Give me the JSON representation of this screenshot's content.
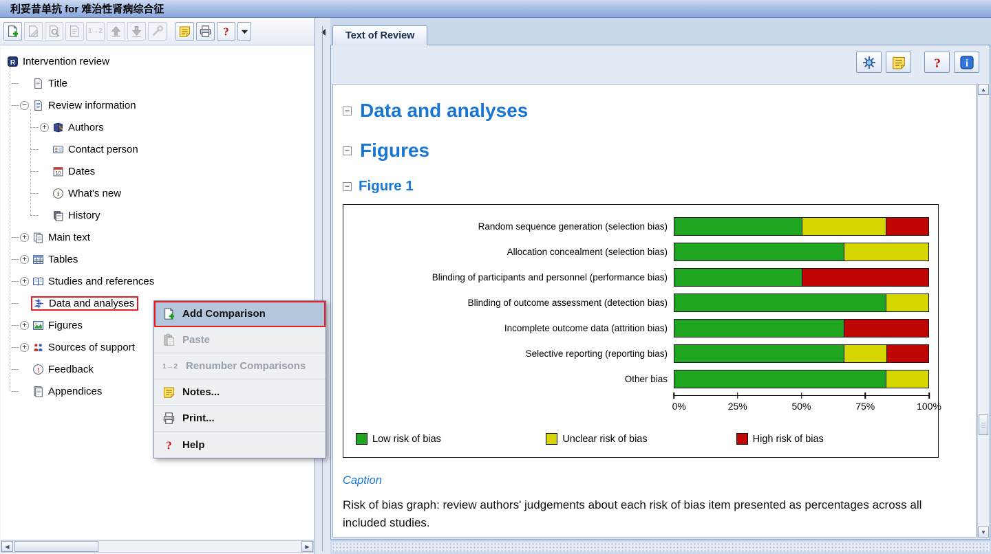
{
  "window": {
    "title": "利妥昔单抗 for 难治性肾病综合征"
  },
  "glyphs": {
    "collapse": "−",
    "expanded": "−",
    "collapsed": "+",
    "up": "▲",
    "down": "▼",
    "left": "◀",
    "right": "▶"
  },
  "colors": {
    "heading_blue": "#1976d2",
    "low_risk_green": "#1fa51f",
    "unclear_yellow": "#d5d500",
    "high_risk_red": "#c00505",
    "annotation_red": "#ec1c24"
  },
  "left_toolbar": {
    "buttons": [
      {
        "name": "new-button",
        "icon": "new-icon",
        "enabled": true
      },
      {
        "name": "edit-button",
        "icon": "edit-icon",
        "enabled": false
      },
      {
        "name": "preview-button",
        "icon": "preview-icon",
        "enabled": false
      },
      {
        "name": "properties-button",
        "icon": "properties-icon",
        "enabled": false
      },
      {
        "name": "renumber-button",
        "icon_text": "1→2",
        "enabled": false
      },
      {
        "name": "move-up-button",
        "icon": "move-up-icon",
        "enabled": false
      },
      {
        "name": "move-down-button",
        "icon": "move-down-icon",
        "enabled": false
      },
      {
        "name": "link-button",
        "icon": "wrench-icon",
        "enabled": false
      },
      {
        "name": "notes-button",
        "icon": "notes-icon",
        "enabled": true
      },
      {
        "name": "print-button",
        "icon": "print-icon",
        "enabled": true
      },
      {
        "name": "help-button",
        "icon": "help-icon",
        "enabled": true
      },
      {
        "name": "toolbar-more-button",
        "icon": "dropdown-icon",
        "enabled": true
      }
    ]
  },
  "tree": {
    "items": [
      {
        "label": "Intervention review",
        "level": 0,
        "icon": "review-icon",
        "handle": null,
        "selected": false
      },
      {
        "label": "Title",
        "level": 1,
        "icon": "title-icon",
        "handle": null,
        "selected": false
      },
      {
        "label": "Review information",
        "level": 1,
        "icon": "review-info-icon",
        "handle": "expanded",
        "selected": false
      },
      {
        "label": "Authors",
        "level": 2,
        "icon": "authors-icon",
        "handle": "collapsed",
        "selected": false
      },
      {
        "label": "Contact person",
        "level": 2,
        "icon": "contact-icon",
        "handle": null,
        "selected": false
      },
      {
        "label": "Dates",
        "level": 2,
        "icon": "dates-icon",
        "handle": null,
        "selected": false
      },
      {
        "label": "What's new",
        "level": 2,
        "icon": "whats-new-icon",
        "handle": null,
        "selected": false
      },
      {
        "label": "History",
        "level": 2,
        "icon": "history-icon",
        "handle": null,
        "selected": false
      },
      {
        "label": "Main text",
        "level": 1,
        "icon": "main-text-icon",
        "handle": "collapsed",
        "selected": false
      },
      {
        "label": "Tables",
        "level": 1,
        "icon": "tables-icon",
        "handle": "collapsed",
        "selected": false
      },
      {
        "label": "Studies and references",
        "level": 1,
        "icon": "studies-icon",
        "handle": "collapsed",
        "selected": false
      },
      {
        "label": "Data and analyses",
        "level": 1,
        "icon": "data-analyses-icon",
        "handle": null,
        "selected": true
      },
      {
        "label": "Figures",
        "level": 1,
        "icon": "figures-icon",
        "handle": "collapsed",
        "selected": false
      },
      {
        "label": "Sources of support",
        "level": 1,
        "icon": "sources-icon",
        "handle": "collapsed",
        "selected": false
      },
      {
        "label": "Feedback",
        "level": 1,
        "icon": "feedback-icon",
        "handle": null,
        "selected": false
      },
      {
        "label": "Appendices",
        "level": 1,
        "icon": "appendices-icon",
        "handle": null,
        "selected": false
      }
    ]
  },
  "context_menu": {
    "items": [
      {
        "label": "Add Comparison",
        "icon": "add-comparison-icon",
        "enabled": true,
        "highlighted": true
      },
      {
        "label": "Paste",
        "icon": "paste-icon",
        "enabled": false,
        "highlighted": false
      },
      {
        "label": "Renumber Comparisons",
        "icon_text": "1→2",
        "enabled": false,
        "highlighted": false
      },
      {
        "label": "Notes...",
        "icon": "notes-icon",
        "enabled": true,
        "highlighted": false
      },
      {
        "label": "Print...",
        "icon": "print-icon",
        "enabled": true,
        "highlighted": false
      },
      {
        "label": "Help",
        "icon": "help-icon",
        "enabled": true,
        "highlighted": false
      }
    ]
  },
  "right_panel": {
    "tab_label": "Text of Review",
    "toolbar": [
      {
        "name": "analyses-button",
        "icon": "gear-icon"
      },
      {
        "name": "notes-button",
        "icon": "notes-icon"
      },
      {
        "name": "help-button",
        "icon": "help-icon",
        "gap": true
      },
      {
        "name": "info-button",
        "icon": "info-icon"
      }
    ],
    "sections": {
      "heading1": "Data and analyses",
      "heading2": "Figures",
      "heading3": "Figure 1"
    },
    "caption_label": "Caption",
    "caption_text": "Risk of bias graph: review authors' judgements about each risk of bias item presented as percentages across all included studies."
  },
  "chart_data": {
    "type": "bar",
    "stacked": true,
    "orientation": "horizontal",
    "title": "Figure 1",
    "categories": [
      "Random sequence generation (selection bias)",
      "Allocation concealment (selection bias)",
      "Blinding of participants and personnel (performance bias)",
      "Blinding of outcome assessment (detection bias)",
      "Incomplete outcome data (attrition bias)",
      "Selective reporting (reporting bias)",
      "Other bias"
    ],
    "series": [
      {
        "name": "Low risk of bias",
        "color": "#1fa51f",
        "values": [
          50,
          66.7,
          50,
          83.3,
          66.7,
          66.7,
          83.3
        ]
      },
      {
        "name": "Unclear risk of bias",
        "color": "#d5d500",
        "values": [
          33.3,
          33.3,
          0,
          16.7,
          0,
          16.7,
          16.7
        ]
      },
      {
        "name": "High risk of bias",
        "color": "#c00505",
        "values": [
          16.7,
          0,
          50,
          0,
          33.3,
          16.6,
          0
        ]
      }
    ],
    "x_ticks": [
      "0%",
      "25%",
      "50%",
      "75%",
      "100%"
    ],
    "xlim": [
      0,
      100
    ],
    "legend_position": "bottom",
    "grid": false
  }
}
